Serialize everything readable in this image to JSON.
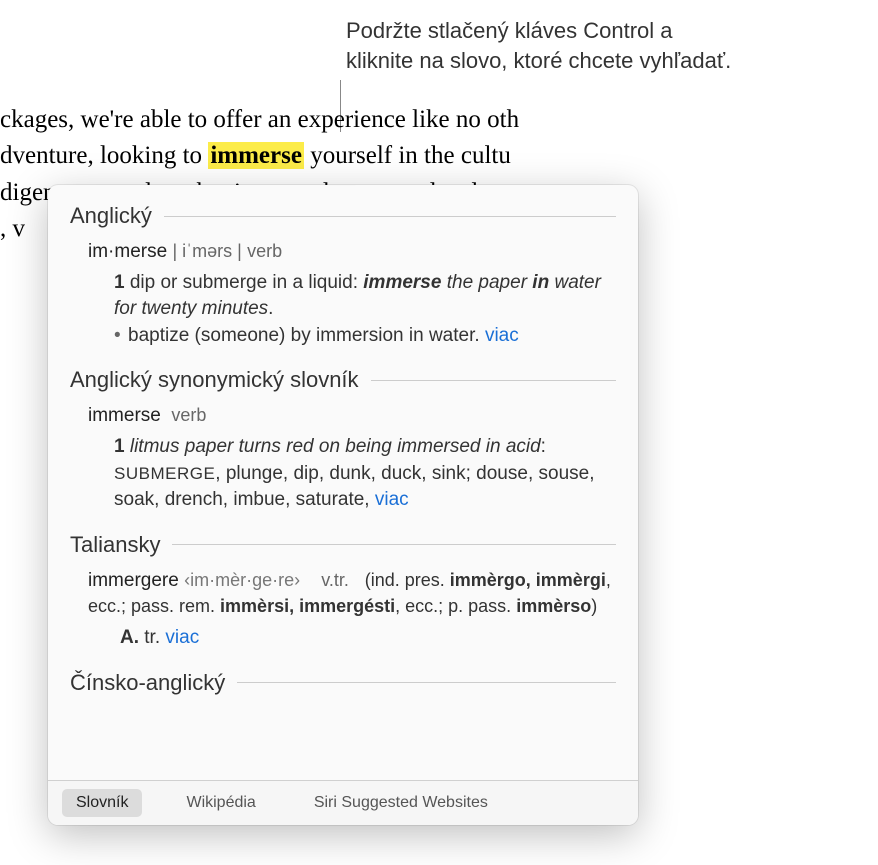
{
  "callout": {
    "line1": "Podržte stlačený kláves Control a",
    "line2": "kliknite na slovo, ktoré chcete vyhľadať."
  },
  "document": {
    "line1_pre": "ckages, we're able to offer an experience like no oth",
    "line2_pre": "dventure, looking to ",
    "line2_highlight": "immerse",
    "line2_post": " yourself in the cultu",
    "line3": "digenous people or hoping to volunteer on local re",
    "line4": ", v"
  },
  "popup": {
    "sections": {
      "english": {
        "title": "Anglický",
        "headword": "im·merse",
        "pronunciation": "| iˈmərs |",
        "pos": "verb",
        "def_num": "1",
        "def_text": "dip or submerge in a liquid: ",
        "example_strong1": "immerse",
        "example_mid": " the paper ",
        "example_strong2": "in",
        "example_rest": " water for twenty minutes",
        "sub_def": "baptize (someone) by immersion in water.",
        "more": "viac"
      },
      "thesaurus": {
        "title": "Anglický synonymický slovník",
        "headword": "immerse",
        "pos": "verb",
        "def_num": "1",
        "example": "litmus paper turns red on being immersed in acid",
        "primary_syn": "SUBMERGE",
        "synonyms": ", plunge, dip, dunk, duck, sink; douse, souse, soak, drench, imbue, saturate, ",
        "more": "viac"
      },
      "italian": {
        "title": "Taliansky",
        "headword": "immergere",
        "syllabified": "‹im·mèr·ge·re›",
        "pos": "v.tr.",
        "conjugation_intro": "(ind. pres. ",
        "conj1": "immèrgo, immèrgi",
        "conj_mid1": ", ecc.; pass. rem. ",
        "conj2": "immèrsi, immergésti",
        "conj_mid2": ", ecc.; p. pass. ",
        "conj3": "immèrso",
        "conj_end": ")",
        "sub_letter": "A.",
        "sub_text": "tr.",
        "more": "viac"
      },
      "chinese": {
        "title": "Čínsko-anglický"
      }
    },
    "footer": {
      "dictionary": "Slovník",
      "wikipedia": "Wikipédia",
      "siri": "Siri Suggested Websites"
    }
  }
}
